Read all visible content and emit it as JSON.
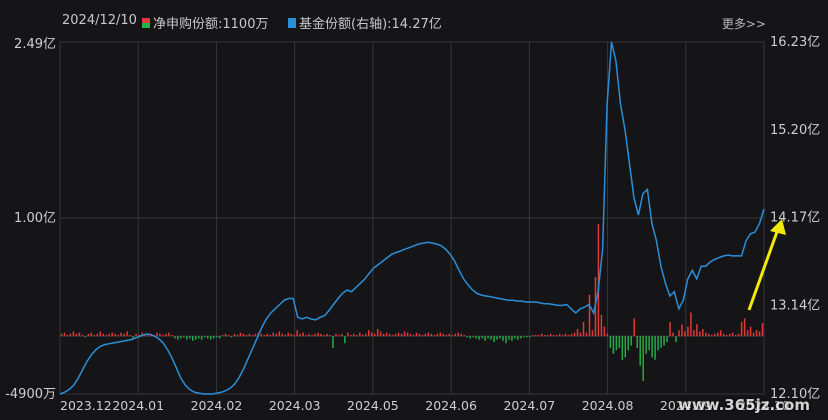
{
  "header": {
    "date": "2024/12/10",
    "series1_label": "净申购份额:1100万",
    "series2_label": "基金份额(右轴):14.27亿",
    "more": "更多>>"
  },
  "colors": {
    "background": "#151518",
    "positive_bar": "#e0393a",
    "negative_bar": "#22ad47",
    "line": "#2b8fd8",
    "grid": "#35353a",
    "arrow": "#f2e80a"
  },
  "watermark": "www.365jz.com",
  "chart_data": {
    "type": "bar+line",
    "x_ticks": [
      "2023.12",
      "2024.01",
      "2024.02",
      "2024.03",
      "2024.05",
      "2024.06",
      "2024.07",
      "2024.08",
      "2024.09",
      "2024.10"
    ],
    "left_axis": {
      "ticks": [
        "2.49亿",
        "1.00亿",
        "-4900万"
      ],
      "range": [
        -0.49,
        2.49
      ],
      "unit": "亿"
    },
    "right_axis": {
      "ticks": [
        "16.23亿",
        "15.20亿",
        "14.17亿",
        "13.14亿",
        "12.10亿"
      ],
      "range": [
        12.1,
        16.23
      ],
      "unit": "亿"
    },
    "series": [
      {
        "name": "净申购份额",
        "axis": "left",
        "kind": "bar",
        "values": [
          0.02,
          0.03,
          0.01,
          0.02,
          0.04,
          0.02,
          0.03,
          0.01,
          -0.01,
          0.02,
          0.03,
          0.01,
          0.02,
          0.04,
          0.02,
          0.01,
          0.02,
          0.03,
          0.02,
          0.01,
          0.03,
          0.02,
          0.04,
          0.01,
          -0.02,
          0.02,
          0.01,
          0.03,
          0.02,
          0.01,
          0.02,
          0.01,
          0.03,
          0.02,
          0.01,
          0.02,
          0.03,
          0.01,
          -0.02,
          -0.03,
          -0.02,
          -0.01,
          -0.03,
          -0.02,
          -0.04,
          -0.03,
          -0.02,
          -0.03,
          -0.01,
          -0.02,
          -0.03,
          -0.02,
          -0.01,
          -0.02,
          0.01,
          0.02,
          0.01,
          -0.01,
          0.02,
          0.01,
          0.03,
          0.02,
          0.01,
          0.02,
          0.01,
          0.02,
          0.03,
          0.02,
          0.01,
          0.02,
          0.01,
          0.03,
          0.02,
          0.04,
          0.02,
          0.01,
          0.03,
          0.02,
          0.01,
          0.05,
          0.02,
          0.03,
          0.01,
          0.02,
          0.01,
          0.02,
          0.03,
          0.02,
          0.01,
          0.02,
          0.01,
          -0.1,
          0.02,
          0.01,
          0.02,
          -0.06,
          0.03,
          0.01,
          0.02,
          0.01,
          0.03,
          0.01,
          0.02,
          0.05,
          0.03,
          0.02,
          0.06,
          0.04,
          0.02,
          0.03,
          0.02,
          0.01,
          0.02,
          0.03,
          0.02,
          0.04,
          0.03,
          0.02,
          0.01,
          0.03,
          0.02,
          0.01,
          0.02,
          0.03,
          0.02,
          0.01,
          0.02,
          0.03,
          0.02,
          0.01,
          0.02,
          0.01,
          0.02,
          0.03,
          0.02,
          0.01,
          -0.01,
          -0.02,
          -0.01,
          -0.02,
          -0.03,
          -0.02,
          -0.04,
          -0.02,
          -0.03,
          -0.05,
          -0.03,
          -0.02,
          -0.04,
          -0.06,
          -0.03,
          -0.04,
          -0.02,
          -0.03,
          -0.02,
          -0.01,
          -0.01,
          -0.01,
          0.01,
          0.01,
          0.01,
          0.02,
          0.01,
          0.01,
          0.02,
          0.01,
          0.01,
          0.02,
          0.01,
          0.02,
          0.01,
          0.02,
          0.03,
          0.06,
          0.03,
          0.12,
          0.03,
          0.35,
          0.05,
          0.5,
          0.95,
          0.18,
          0.08,
          0.02,
          -0.1,
          -0.15,
          -0.12,
          -0.1,
          -0.2,
          -0.18,
          -0.12,
          -0.08,
          0.15,
          -0.1,
          -0.25,
          -0.38,
          -0.15,
          -0.12,
          -0.18,
          -0.2,
          -0.12,
          -0.1,
          -0.08,
          -0.05,
          0.12,
          0.03,
          -0.05,
          0.05,
          0.1,
          0.04,
          0.08,
          0.2,
          0.05,
          0.1,
          0.04,
          0.06,
          0.03,
          0.02,
          0.01,
          0.02,
          0.03,
          0.05,
          0.02,
          0.01,
          0.02,
          0.03,
          0.01,
          0.02,
          0.12,
          0.15,
          0.05,
          0.08,
          0.03,
          0.05,
          0.04,
          0.11
        ]
      },
      {
        "name": "基金份额",
        "axis": "right",
        "kind": "line",
        "values": [
          12.1,
          12.12,
          12.15,
          12.2,
          12.28,
          12.38,
          12.48,
          12.56,
          12.62,
          12.66,
          12.68,
          12.69,
          12.7,
          12.71,
          12.72,
          12.73,
          12.74,
          12.76,
          12.78,
          12.8,
          12.8,
          12.78,
          12.75,
          12.7,
          12.62,
          12.52,
          12.4,
          12.28,
          12.2,
          12.15,
          12.12,
          12.11,
          12.1,
          12.1,
          12.1,
          12.11,
          12.12,
          12.14,
          12.17,
          12.22,
          12.3,
          12.4,
          12.52,
          12.64,
          12.76,
          12.88,
          12.98,
          13.05,
          13.1,
          13.15,
          13.2,
          13.22,
          13.22,
          13.0,
          12.98,
          13.0,
          12.98,
          12.97,
          13.0,
          13.02,
          13.08,
          13.15,
          13.22,
          13.28,
          13.32,
          13.3,
          13.35,
          13.4,
          13.45,
          13.52,
          13.58,
          13.62,
          13.66,
          13.7,
          13.74,
          13.76,
          13.78,
          13.8,
          13.82,
          13.84,
          13.86,
          13.87,
          13.88,
          13.87,
          13.86,
          13.84,
          13.8,
          13.74,
          13.66,
          13.55,
          13.45,
          13.38,
          13.32,
          13.28,
          13.26,
          13.25,
          13.24,
          13.23,
          13.22,
          13.21,
          13.2,
          13.2,
          13.19,
          13.19,
          13.18,
          13.18,
          13.18,
          13.17,
          13.16,
          13.16,
          13.15,
          13.14,
          13.14,
          13.15,
          13.1,
          13.05,
          13.1,
          13.12,
          13.15,
          13.05,
          13.3,
          13.8,
          15.5,
          16.23,
          16.0,
          15.5,
          15.2,
          14.8,
          14.4,
          14.2,
          14.45,
          14.5,
          14.1,
          13.9,
          13.6,
          13.4,
          13.25,
          13.3,
          13.1,
          13.2,
          13.45,
          13.55,
          13.45,
          13.6,
          13.6,
          13.65,
          13.68,
          13.7,
          13.72,
          13.73,
          13.72,
          13.72,
          13.72,
          13.9,
          13.98,
          14.0,
          14.1,
          14.27
        ]
      }
    ],
    "bar_date_range": [
      "2023.12",
      "2024.12.10"
    ],
    "annotation": {
      "type": "arrow",
      "target": "line-end"
    }
  }
}
